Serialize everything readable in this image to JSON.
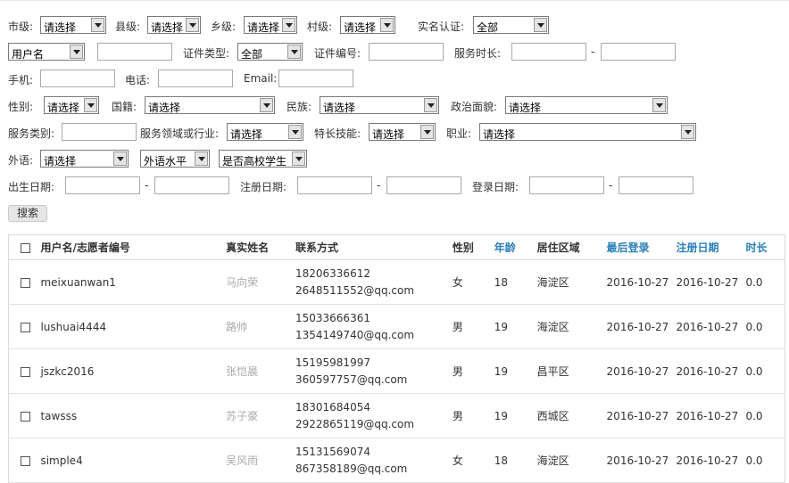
{
  "filters": {
    "city_label": "市级:",
    "city_value": "请选择",
    "county_label": "县级:",
    "county_value": "请选择",
    "township_label": "乡级:",
    "township_value": "请选择",
    "village_label": "村级:",
    "village_value": "请选择",
    "realname_label": "实名认证:",
    "realname_value": "全部",
    "user_type_value": "用户名",
    "id_type_label": "证件类型:",
    "id_type_value": "全部",
    "id_no_label": "证件编号:",
    "service_hours_label": "服务时长:",
    "phone_label": "手机:",
    "tel_label": "电话:",
    "email_label": "Email:",
    "gender_label": "性别:",
    "gender_value": "请选择",
    "nationality_label": "国籍:",
    "nationality_value": "请选择",
    "ethnicity_label": "民族:",
    "ethnicity_value": "请选择",
    "political_label": "政治面貌:",
    "political_value": "请选择",
    "service_type_label": "服务类别:",
    "service_field_label": "服务领域或行业:",
    "service_field_value": "请选择",
    "skill_label": "特长技能:",
    "skill_value": "请选择",
    "occupation_label": "职业:",
    "occupation_value": "请选择",
    "language_label": "外语:",
    "language_value": "请选择",
    "language_level_value": "外语水平",
    "student_value": "是否高校学生",
    "birth_label": "出生日期:",
    "register_label": "注册日期:",
    "login_label": "登录日期:",
    "dash": "-"
  },
  "search_button": "搜索",
  "table": {
    "headers": [
      "用户名/志愿者编号",
      "真实姓名",
      "联系方式",
      "性别",
      "年龄",
      "居住区域",
      "最后登录",
      "注册日期",
      "时长"
    ],
    "rows": [
      {
        "user": "meixuanwan1",
        "name": "马向荣",
        "phone": "18206336612",
        "email": "2648511552@qq.com",
        "gender": "女",
        "age": "18",
        "area": "海淀区",
        "last_login": "2016-10-27",
        "registered": "2016-10-27",
        "hours": "0.0"
      },
      {
        "user": "lushuai4444",
        "name": "路帅",
        "phone": "15033666361",
        "email": "1354149740@qq.com",
        "gender": "男",
        "age": "19",
        "area": "海淀区",
        "last_login": "2016-10-27",
        "registered": "2016-10-27",
        "hours": "0.0"
      },
      {
        "user": "jszkc2016",
        "name": "张恺晨",
        "phone": "15195981997",
        "email": "360597757@qq.com",
        "gender": "男",
        "age": "19",
        "area": "昌平区",
        "last_login": "2016-10-27",
        "registered": "2016-10-27",
        "hours": "0.0"
      },
      {
        "user": "tawsss",
        "name": "苏子豪",
        "phone": "18301684054",
        "email": "2922865119@qq.com",
        "gender": "男",
        "age": "19",
        "area": "西城区",
        "last_login": "2016-10-27",
        "registered": "2016-10-27",
        "hours": "0.0"
      },
      {
        "user": "simple4",
        "name": "吴风雨",
        "phone": "15131569074",
        "email": "867358189@qq.com",
        "gender": "女",
        "age": "18",
        "area": "海淀区",
        "last_login": "2016-10-27",
        "registered": "2016-10-27",
        "hours": "0.0"
      }
    ]
  },
  "colors": {
    "header_link": "#2a7fb8",
    "name_text": "#aaaaaa"
  }
}
